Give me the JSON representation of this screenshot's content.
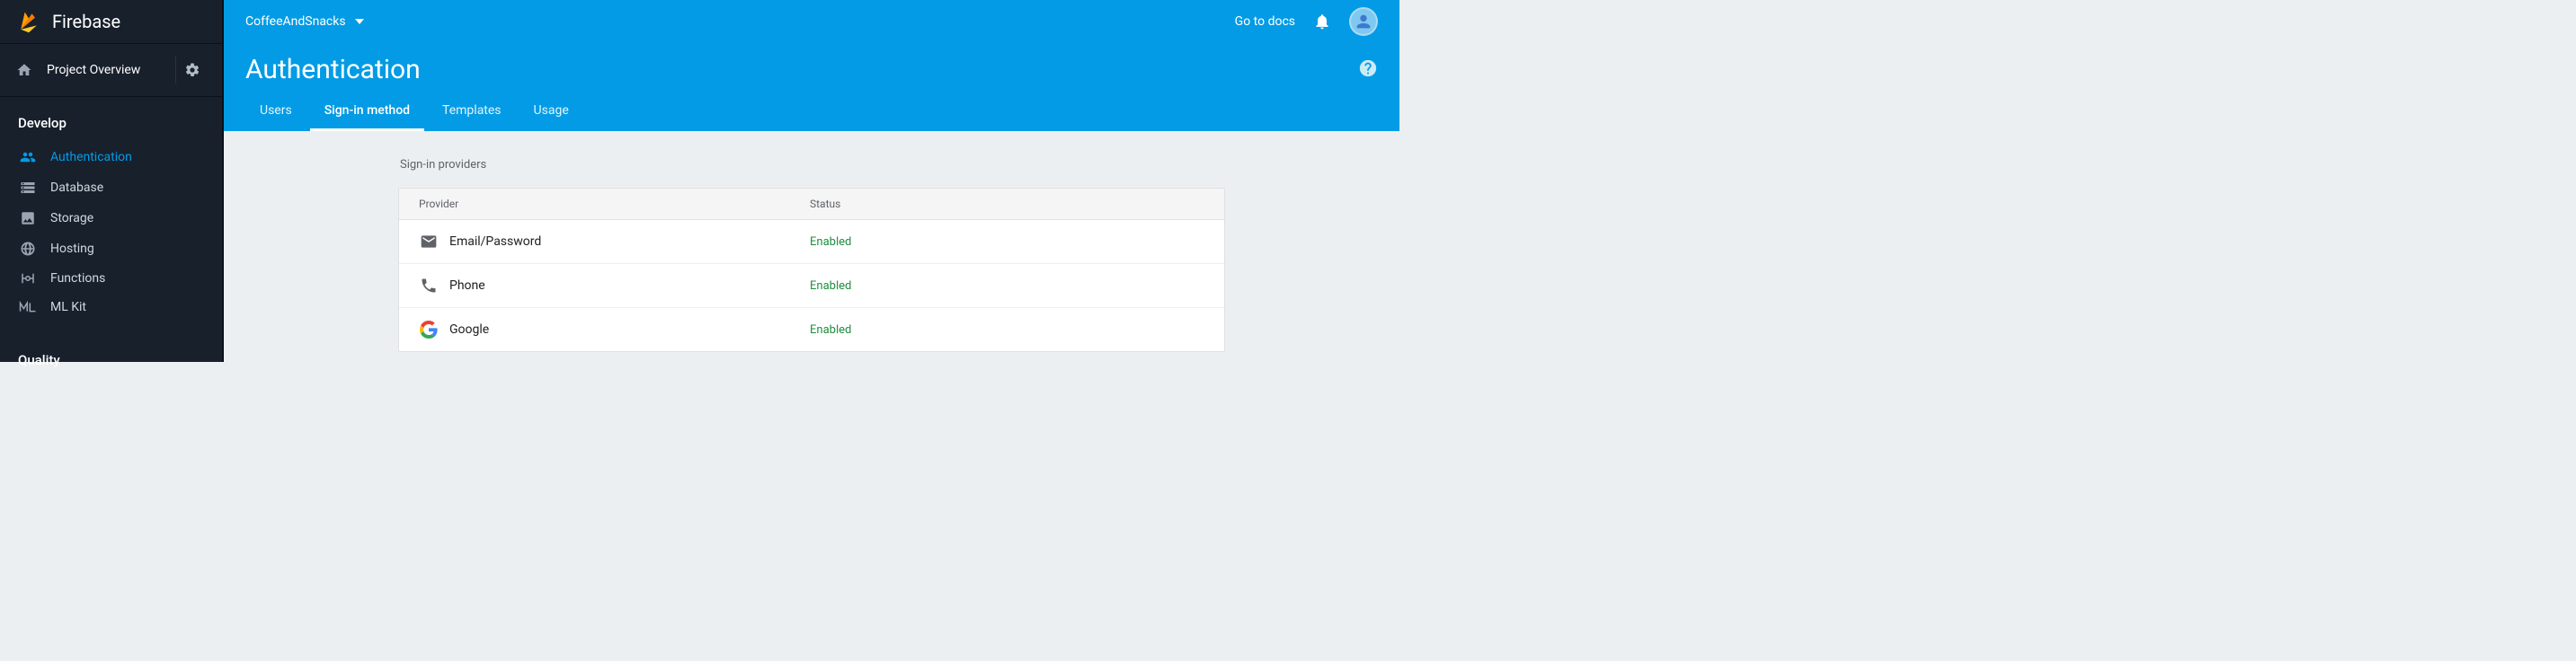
{
  "brand": {
    "name": "Firebase"
  },
  "overview": {
    "label": "Project Overview"
  },
  "sections": {
    "develop": {
      "title": "Develop",
      "items": [
        {
          "id": "authentication",
          "label": "Authentication",
          "active": true
        },
        {
          "id": "database",
          "label": "Database"
        },
        {
          "id": "storage",
          "label": "Storage"
        },
        {
          "id": "hosting",
          "label": "Hosting"
        },
        {
          "id": "functions",
          "label": "Functions"
        },
        {
          "id": "mlkit",
          "label": "ML Kit"
        }
      ]
    },
    "quality": {
      "title": "Quality"
    }
  },
  "topbar": {
    "project_name": "CoffeeAndSnacks",
    "docs_label": "Go to docs"
  },
  "page": {
    "title": "Authentication"
  },
  "tabs": [
    {
      "id": "users",
      "label": "Users"
    },
    {
      "id": "signin",
      "label": "Sign-in method",
      "active": true
    },
    {
      "id": "templates",
      "label": "Templates"
    },
    {
      "id": "usage",
      "label": "Usage"
    }
  ],
  "providers_section": {
    "title": "Sign-in providers",
    "columns": {
      "provider": "Provider",
      "status": "Status"
    },
    "rows": [
      {
        "icon": "email",
        "name": "Email/Password",
        "status": "Enabled"
      },
      {
        "icon": "phone",
        "name": "Phone",
        "status": "Enabled"
      },
      {
        "icon": "google",
        "name": "Google",
        "status": "Enabled"
      }
    ]
  }
}
